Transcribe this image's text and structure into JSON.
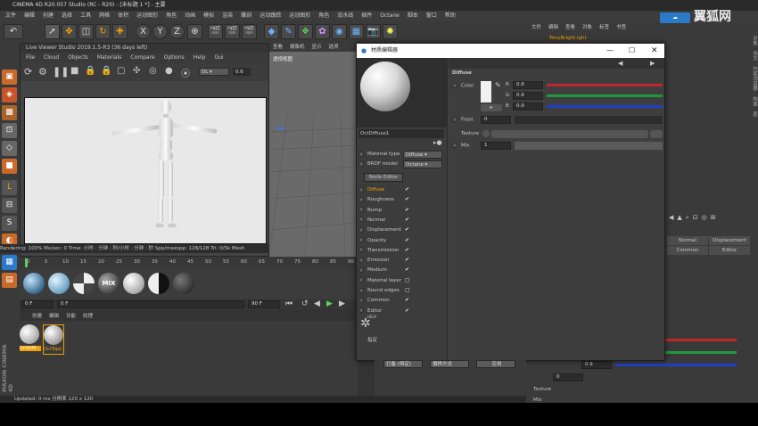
{
  "window": {
    "title": "CINEMA 4D R20.057 Studio (RC - R20) - [未标题 1 *] - 主要"
  },
  "menu": [
    "文件",
    "编辑",
    "创建",
    "选择",
    "工具",
    "网格",
    "体积",
    "运动图形",
    "角色",
    "动画",
    "模拟",
    "渲染",
    "雕刻",
    "运动跟踪",
    "运动图形",
    "角色",
    "流水线",
    "插件",
    "Octane",
    "脚本",
    "窗口",
    "帮助"
  ],
  "toolbar": {
    "xyz": [
      "X",
      "Y",
      "Z"
    ]
  },
  "viewer": {
    "title": "Live Viewer Studio 2019.1.5-R3 (36 days left)",
    "menus": [
      "File",
      "Cloud",
      "Objects",
      "Materials",
      "Compare",
      "Options",
      "Help",
      "Gui"
    ],
    "mode": "DL",
    "value": "0.6",
    "status": "Rendering: 100%   Ms/sec: 0   Time: 小时 : 分钟 : 秒/小时 : 分钟 : 秒   Spp/maxspp: 128/128   Tri: 0/5k   Mesh"
  },
  "viewport3d": {
    "tabs": [
      "查看",
      "摄像机",
      "显示",
      "选项"
    ],
    "label": "透视视图"
  },
  "timeline": {
    "ticks": [
      "0",
      "5",
      "10",
      "15",
      "20",
      "25",
      "30",
      "35",
      "40",
      "45",
      "50",
      "55",
      "60",
      "65",
      "70",
      "75",
      "80",
      "85",
      "90"
    ],
    "start": "0 F",
    "cur": "0 F",
    "end": "90 F"
  },
  "matballs": [
    "MIX"
  ],
  "matmgr": {
    "menus": [
      "创建",
      "编辑",
      "功能",
      "纹理"
    ],
    "items": [
      "OctDiffi",
      "OctTopo"
    ]
  },
  "status_bottom": "Updated: 0 ms      分辨率 120 x 120",
  "dialog": {
    "title": "材质编辑器",
    "material_name": "OctDiffuse1",
    "material_type_label": "Material type",
    "material_type": "Diffuse",
    "brdf_label": "BRDF model",
    "brdf": "Octane",
    "node_editor": "Node Editor",
    "channels": [
      {
        "label": "Diffuse",
        "checked": true,
        "active": true
      },
      {
        "label": "Roughness",
        "checked": true
      },
      {
        "label": "Bump",
        "checked": true
      },
      {
        "label": "Normal",
        "checked": true
      },
      {
        "label": "Displacement",
        "checked": true
      },
      {
        "label": "Opacity",
        "checked": true
      },
      {
        "label": "Transmission",
        "checked": true
      },
      {
        "label": "Emission",
        "checked": true
      },
      {
        "label": "Medium",
        "checked": true
      },
      {
        "label": "Material layer",
        "checked": false
      },
      {
        "label": "Round edges",
        "checked": false
      },
      {
        "label": "Common",
        "checked": true
      },
      {
        "label": "Editor",
        "checked": true
      }
    ],
    "help": "HELP",
    "assign": "指定",
    "section": "Diffuse",
    "color_label": "Color",
    "r_label": "R",
    "r": "0.9",
    "g_label": "G",
    "g": "0.9",
    "b_label": "B",
    "b": "0.9",
    "float_label": "Float",
    "float": "0",
    "texture_label": "Texture",
    "mix_label": "Mix",
    "mix": "1",
    "bottom": [
      "打备 (恒定)",
      "偏移方式",
      "应用"
    ]
  },
  "rightpanel": {
    "tabs": [
      "文件",
      "编辑",
      "查看",
      "对象",
      "标签",
      "书签"
    ],
    "object": "TonyBright.ight",
    "cols": [
      "Normal",
      "Displacement"
    ],
    "cols2": [
      "Common",
      "Editor"
    ],
    "b": "0.9",
    "float": "0",
    "texture": "Texture",
    "mix": "Mix"
  },
  "side_labels": [
    "对象",
    "场次",
    "内容浏览器",
    "构造",
    "层"
  ],
  "watermark": "翼狐网",
  "colors": {
    "r": "#c0262b",
    "g": "#1f9a3a",
    "b": "#1f3fc4",
    "accent": "#f0a000"
  }
}
